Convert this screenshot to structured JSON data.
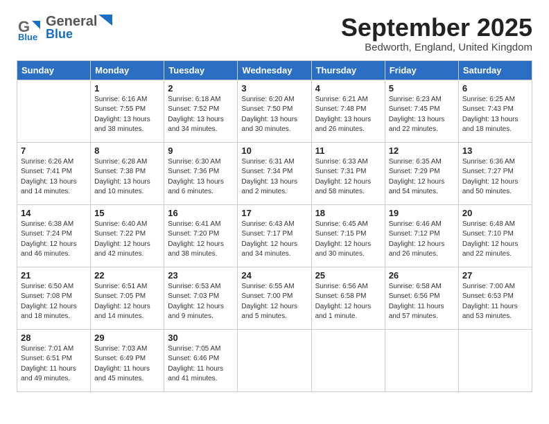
{
  "header": {
    "logo_general": "General",
    "logo_blue": "Blue",
    "month_title": "September 2025",
    "location": "Bedworth, England, United Kingdom"
  },
  "days_of_week": [
    "Sunday",
    "Monday",
    "Tuesday",
    "Wednesday",
    "Thursday",
    "Friday",
    "Saturday"
  ],
  "weeks": [
    [
      {
        "day": "",
        "info": ""
      },
      {
        "day": "1",
        "info": "Sunrise: 6:16 AM\nSunset: 7:55 PM\nDaylight: 13 hours\nand 38 minutes."
      },
      {
        "day": "2",
        "info": "Sunrise: 6:18 AM\nSunset: 7:52 PM\nDaylight: 13 hours\nand 34 minutes."
      },
      {
        "day": "3",
        "info": "Sunrise: 6:20 AM\nSunset: 7:50 PM\nDaylight: 13 hours\nand 30 minutes."
      },
      {
        "day": "4",
        "info": "Sunrise: 6:21 AM\nSunset: 7:48 PM\nDaylight: 13 hours\nand 26 minutes."
      },
      {
        "day": "5",
        "info": "Sunrise: 6:23 AM\nSunset: 7:45 PM\nDaylight: 13 hours\nand 22 minutes."
      },
      {
        "day": "6",
        "info": "Sunrise: 6:25 AM\nSunset: 7:43 PM\nDaylight: 13 hours\nand 18 minutes."
      }
    ],
    [
      {
        "day": "7",
        "info": "Sunrise: 6:26 AM\nSunset: 7:41 PM\nDaylight: 13 hours\nand 14 minutes."
      },
      {
        "day": "8",
        "info": "Sunrise: 6:28 AM\nSunset: 7:38 PM\nDaylight: 13 hours\nand 10 minutes."
      },
      {
        "day": "9",
        "info": "Sunrise: 6:30 AM\nSunset: 7:36 PM\nDaylight: 13 hours\nand 6 minutes."
      },
      {
        "day": "10",
        "info": "Sunrise: 6:31 AM\nSunset: 7:34 PM\nDaylight: 13 hours\nand 2 minutes."
      },
      {
        "day": "11",
        "info": "Sunrise: 6:33 AM\nSunset: 7:31 PM\nDaylight: 12 hours\nand 58 minutes."
      },
      {
        "day": "12",
        "info": "Sunrise: 6:35 AM\nSunset: 7:29 PM\nDaylight: 12 hours\nand 54 minutes."
      },
      {
        "day": "13",
        "info": "Sunrise: 6:36 AM\nSunset: 7:27 PM\nDaylight: 12 hours\nand 50 minutes."
      }
    ],
    [
      {
        "day": "14",
        "info": "Sunrise: 6:38 AM\nSunset: 7:24 PM\nDaylight: 12 hours\nand 46 minutes."
      },
      {
        "day": "15",
        "info": "Sunrise: 6:40 AM\nSunset: 7:22 PM\nDaylight: 12 hours\nand 42 minutes."
      },
      {
        "day": "16",
        "info": "Sunrise: 6:41 AM\nSunset: 7:20 PM\nDaylight: 12 hours\nand 38 minutes."
      },
      {
        "day": "17",
        "info": "Sunrise: 6:43 AM\nSunset: 7:17 PM\nDaylight: 12 hours\nand 34 minutes."
      },
      {
        "day": "18",
        "info": "Sunrise: 6:45 AM\nSunset: 7:15 PM\nDaylight: 12 hours\nand 30 minutes."
      },
      {
        "day": "19",
        "info": "Sunrise: 6:46 AM\nSunset: 7:12 PM\nDaylight: 12 hours\nand 26 minutes."
      },
      {
        "day": "20",
        "info": "Sunrise: 6:48 AM\nSunset: 7:10 PM\nDaylight: 12 hours\nand 22 minutes."
      }
    ],
    [
      {
        "day": "21",
        "info": "Sunrise: 6:50 AM\nSunset: 7:08 PM\nDaylight: 12 hours\nand 18 minutes."
      },
      {
        "day": "22",
        "info": "Sunrise: 6:51 AM\nSunset: 7:05 PM\nDaylight: 12 hours\nand 14 minutes."
      },
      {
        "day": "23",
        "info": "Sunrise: 6:53 AM\nSunset: 7:03 PM\nDaylight: 12 hours\nand 9 minutes."
      },
      {
        "day": "24",
        "info": "Sunrise: 6:55 AM\nSunset: 7:00 PM\nDaylight: 12 hours\nand 5 minutes."
      },
      {
        "day": "25",
        "info": "Sunrise: 6:56 AM\nSunset: 6:58 PM\nDaylight: 12 hours\nand 1 minute."
      },
      {
        "day": "26",
        "info": "Sunrise: 6:58 AM\nSunset: 6:56 PM\nDaylight: 11 hours\nand 57 minutes."
      },
      {
        "day": "27",
        "info": "Sunrise: 7:00 AM\nSunset: 6:53 PM\nDaylight: 11 hours\nand 53 minutes."
      }
    ],
    [
      {
        "day": "28",
        "info": "Sunrise: 7:01 AM\nSunset: 6:51 PM\nDaylight: 11 hours\nand 49 minutes."
      },
      {
        "day": "29",
        "info": "Sunrise: 7:03 AM\nSunset: 6:49 PM\nDaylight: 11 hours\nand 45 minutes."
      },
      {
        "day": "30",
        "info": "Sunrise: 7:05 AM\nSunset: 6:46 PM\nDaylight: 11 hours\nand 41 minutes."
      },
      {
        "day": "",
        "info": ""
      },
      {
        "day": "",
        "info": ""
      },
      {
        "day": "",
        "info": ""
      },
      {
        "day": "",
        "info": ""
      }
    ]
  ]
}
